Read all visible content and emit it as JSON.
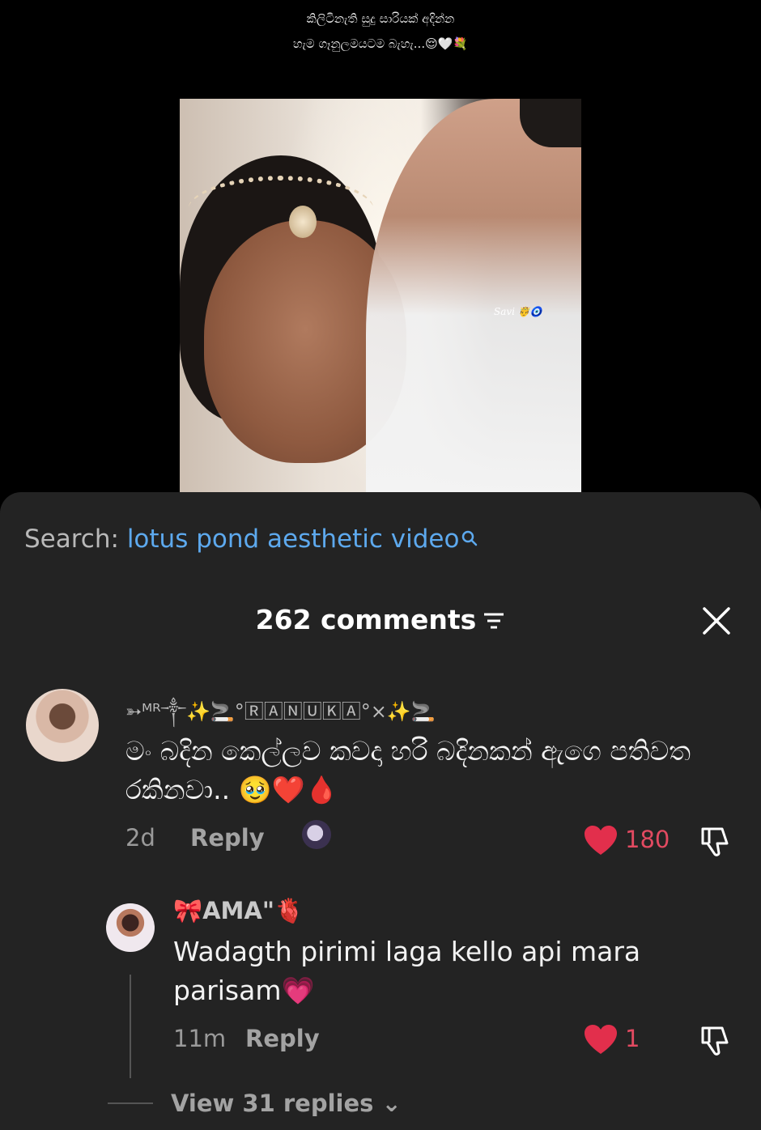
{
  "caption": {
    "line1": "කිලිටිනැති සුදු සාරියක් අදින්න",
    "line2": "හැම ගෑනුලමයටම බැහැ...😌🤍💐"
  },
  "video": {
    "watermark": "Savi 🤴🧿"
  },
  "search": {
    "label": "Search:",
    "query": "lotus pond aesthetic video",
    "icon": "search-icon"
  },
  "comments_header": {
    "count_label": "262 comments",
    "filter_icon": "filter-icon",
    "close_icon": "close-icon"
  },
  "comments": [
    {
      "username": "➳ᴹᴿ༒✨🚬°🅁🄰🄽🅄🄺🄰°×✨🚬",
      "text": "මං බදින කෙල්ලව කවදා හරි බදිනකන් ඇගෙ පතිවත රකිනවා.. 🥹❤️🩸",
      "time": "2d",
      "reply_label": "Reply",
      "likes": "180"
    }
  ],
  "replies": [
    {
      "username": "🎀AMA\"🫀",
      "text": "Wadagth pirimi laga kello api mara parisam💗",
      "time": "11m",
      "reply_label": "Reply",
      "likes": "1"
    }
  ],
  "view_replies": "View 31 replies ⌄",
  "colors": {
    "accent_link": "#5da9ee",
    "like_red": "#e24a61",
    "sheet_bg": "#232323"
  }
}
